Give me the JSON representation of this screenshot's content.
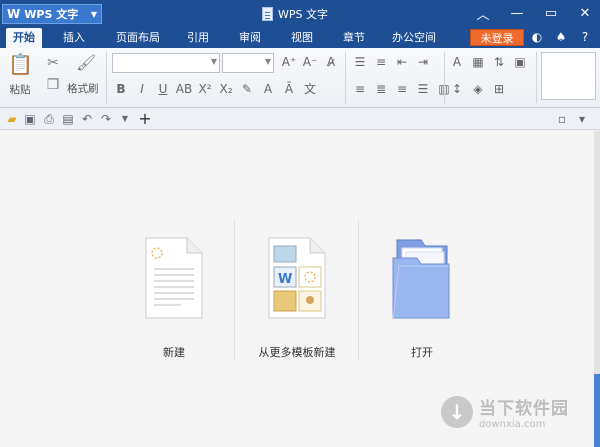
{
  "app": {
    "menu_label": "WPS 文字",
    "window_title": "WPS 文字"
  },
  "tabs": [
    {
      "label": "开始",
      "active": true
    },
    {
      "label": "插入"
    },
    {
      "label": "页面布局"
    },
    {
      "label": "引用"
    },
    {
      "label": "审阅"
    },
    {
      "label": "视图"
    },
    {
      "label": "章节"
    },
    {
      "label": "办公空间"
    }
  ],
  "login_button": "未登录",
  "ribbon": {
    "paste_label": "粘贴",
    "format_painter_label": "格式刷"
  },
  "launcher": {
    "new": {
      "label": "新建"
    },
    "template": {
      "label": "从更多模板新建"
    },
    "open": {
      "label": "打开"
    }
  },
  "watermark": {
    "name": "当下软件园",
    "url": "downxia.com"
  },
  "colors": {
    "title_bar": "#1e4f95",
    "accent": "#3b78cf",
    "login": "#f06a2e"
  }
}
